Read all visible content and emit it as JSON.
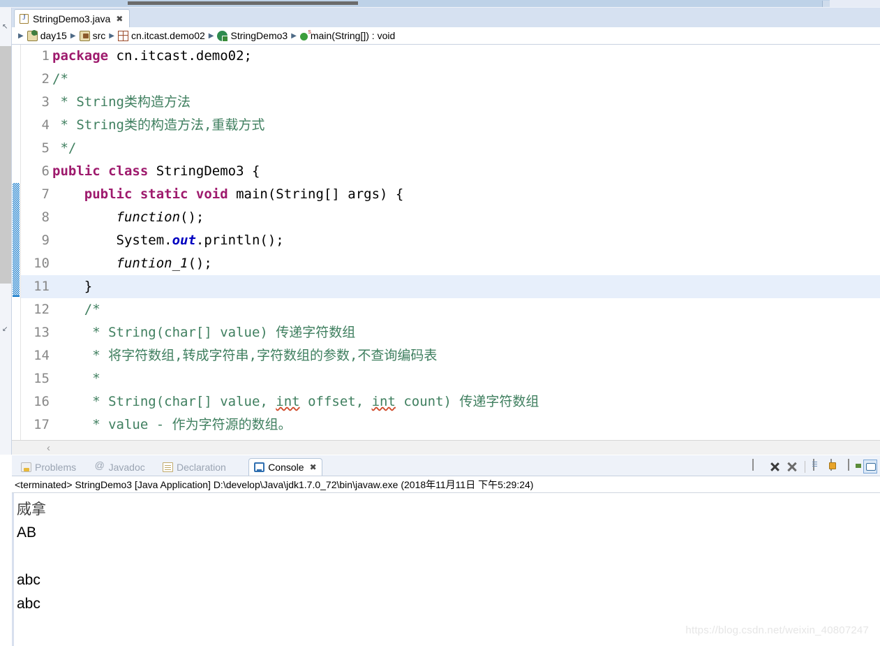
{
  "window": {
    "top_scrollbar": "horizontal-scrollbar"
  },
  "editor": {
    "tab": {
      "label": "StringDemo3.java",
      "close": "✖",
      "icon": "java-file-icon"
    },
    "breadcrumb": [
      {
        "label": "day15",
        "icon": "project-icon"
      },
      {
        "label": "src",
        "icon": "source-folder-icon"
      },
      {
        "label": "cn.itcast.demo02",
        "icon": "package-icon"
      },
      {
        "label": "StringDemo3",
        "icon": "class-icon"
      },
      {
        "label": "main(String[]) : void",
        "icon": "method-icon"
      }
    ],
    "separator": "▶",
    "scroll_left_arrow": "‹",
    "code": [
      {
        "n": "1",
        "highlight": false,
        "parts": [
          {
            "t": "package",
            "c": "kw"
          },
          {
            "t": " cn.itcast.demo02;",
            "c": ""
          }
        ]
      },
      {
        "n": "2",
        "highlight": false,
        "parts": [
          {
            "t": "/*",
            "c": "cmt"
          }
        ]
      },
      {
        "n": "3",
        "highlight": false,
        "parts": [
          {
            "t": " * String类构造方法",
            "c": "cmt"
          }
        ]
      },
      {
        "n": "4",
        "highlight": false,
        "parts": [
          {
            "t": " * String类的构造方法,重载方式",
            "c": "cmt"
          }
        ]
      },
      {
        "n": "5",
        "highlight": false,
        "parts": [
          {
            "t": " */",
            "c": "cmt"
          }
        ]
      },
      {
        "n": "6",
        "highlight": false,
        "parts": [
          {
            "t": "public class",
            "c": "kw"
          },
          {
            "t": " StringDemo3 {",
            "c": ""
          }
        ]
      },
      {
        "n": "7",
        "highlight": false,
        "parts": [
          {
            "t": "    ",
            "c": ""
          },
          {
            "t": "public static void",
            "c": "kw"
          },
          {
            "t": " main(String[] args) {",
            "c": ""
          }
        ]
      },
      {
        "n": "8",
        "highlight": false,
        "parts": [
          {
            "t": "        ",
            "c": ""
          },
          {
            "t": "function",
            "c": "stat"
          },
          {
            "t": "();",
            "c": ""
          }
        ]
      },
      {
        "n": "9",
        "highlight": false,
        "parts": [
          {
            "t": "        System.",
            "c": ""
          },
          {
            "t": "out",
            "c": "field"
          },
          {
            "t": ".println();",
            "c": ""
          }
        ]
      },
      {
        "n": "10",
        "highlight": false,
        "parts": [
          {
            "t": "        ",
            "c": ""
          },
          {
            "t": "funtion_1",
            "c": "stat"
          },
          {
            "t": "();",
            "c": ""
          }
        ]
      },
      {
        "n": "11",
        "highlight": true,
        "parts": [
          {
            "t": "    }",
            "c": ""
          }
        ]
      },
      {
        "n": "12",
        "highlight": false,
        "parts": [
          {
            "t": "    /*",
            "c": "cmt"
          }
        ]
      },
      {
        "n": "13",
        "highlight": false,
        "parts": [
          {
            "t": "     * String(char[] value) 传递字符数组",
            "c": "cmt"
          }
        ]
      },
      {
        "n": "14",
        "highlight": false,
        "parts": [
          {
            "t": "     * 将字符数组,转成字符串,字符数组的参数,不查询编码表",
            "c": "cmt"
          }
        ]
      },
      {
        "n": "15",
        "highlight": false,
        "parts": [
          {
            "t": "     *",
            "c": "cmt"
          }
        ]
      },
      {
        "n": "16",
        "highlight": false,
        "parts": [
          {
            "t": "     * String(char[] value, ",
            "c": "cmt"
          },
          {
            "t": "int",
            "c": "cmt err"
          },
          {
            "t": " offset, ",
            "c": "cmt"
          },
          {
            "t": "int",
            "c": "cmt err"
          },
          {
            "t": " count) 传递字符数组",
            "c": "cmt"
          }
        ]
      },
      {
        "n": "17",
        "highlight": false,
        "parts": [
          {
            "t": "     * value - 作为字符源的数组。",
            "c": "cmt"
          }
        ]
      }
    ]
  },
  "console_view": {
    "tabs": [
      {
        "label": "Problems",
        "icon": "problems-icon",
        "active": false,
        "closable": false
      },
      {
        "label": "Javadoc",
        "icon": "javadoc-icon",
        "active": false,
        "closable": false
      },
      {
        "label": "Declaration",
        "icon": "declaration-icon",
        "active": false,
        "closable": false
      },
      {
        "label": "Console",
        "icon": "console-icon",
        "active": true,
        "closable": true
      }
    ],
    "tab_close": "✖",
    "toolbar": [
      {
        "name": "terminate-icon"
      },
      {
        "name": "remove-launch-icon"
      },
      {
        "name": "remove-all-terminated-icon"
      },
      {
        "name": "toolbar-divider"
      },
      {
        "name": "clear-console-icon"
      },
      {
        "name": "scroll-lock-icon"
      },
      {
        "name": "pin-console-icon"
      },
      {
        "name": "display-selected-console-icon"
      }
    ],
    "status_line": "<terminated> StringDemo3 [Java Application] D:\\develop\\Java\\jdk1.7.0_72\\bin\\javaw.exe (2018年11月11日 下午5:29:24)",
    "output": [
      {
        "text": "烕拿",
        "cjk": true
      },
      {
        "text": "AB",
        "cjk": false
      },
      {
        "text": "",
        "cjk": false
      },
      {
        "text": "abc",
        "cjk": false
      },
      {
        "text": "abc",
        "cjk": false
      }
    ]
  },
  "watermark": "https://blog.csdn.net/weixin_40807247",
  "colors": {
    "keyword": "#9e1a6d",
    "comment": "#3f7f5f",
    "field": "#0000c0",
    "error_squiggle": "#d04a2a",
    "current_line": "#e7effb",
    "fold_marker": "#0e76c8"
  }
}
